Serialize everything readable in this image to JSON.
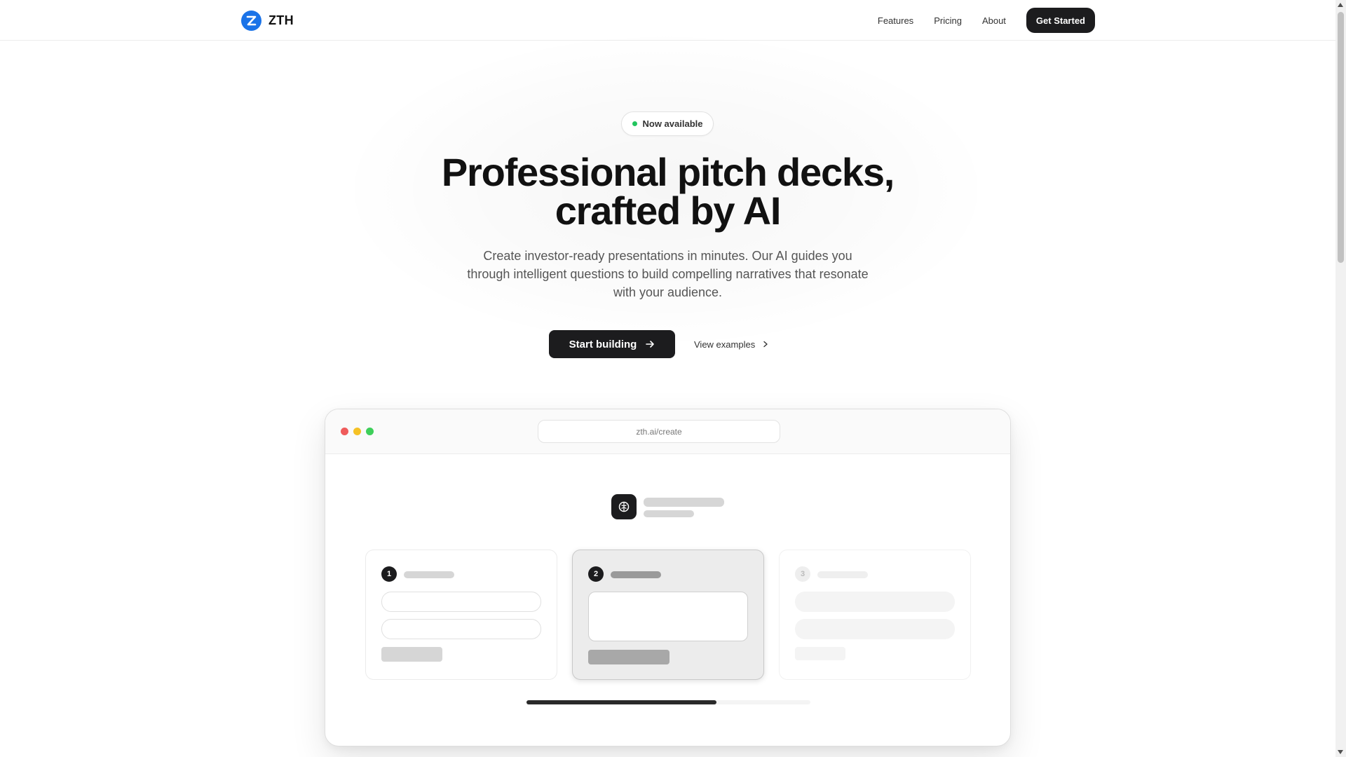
{
  "header": {
    "brand": "ZTH",
    "nav": [
      "Features",
      "Pricing",
      "About"
    ],
    "cta": "Get Started"
  },
  "hero": {
    "badge": "Now available",
    "headline_line1": "Professional pitch decks,",
    "headline_line2": "crafted by AI",
    "subtext": "Create investor-ready presentations in minutes. Our AI guides you through intelligent questions to build compelling narratives that resonate with your audience.",
    "primary_button": "Start building",
    "secondary_button": "View examples"
  },
  "mockup": {
    "url": "zth.ai/create",
    "steps": [
      "1",
      "2",
      "3"
    ],
    "active_step": 2,
    "progress_fraction": 0.67,
    "window_dot_colors": [
      "#ef5b5b",
      "#f5c125",
      "#3ecf5a"
    ]
  },
  "colors": {
    "accent": "#1a73e8",
    "dark": "#1c1c1e",
    "status_green": "#22c55e"
  }
}
